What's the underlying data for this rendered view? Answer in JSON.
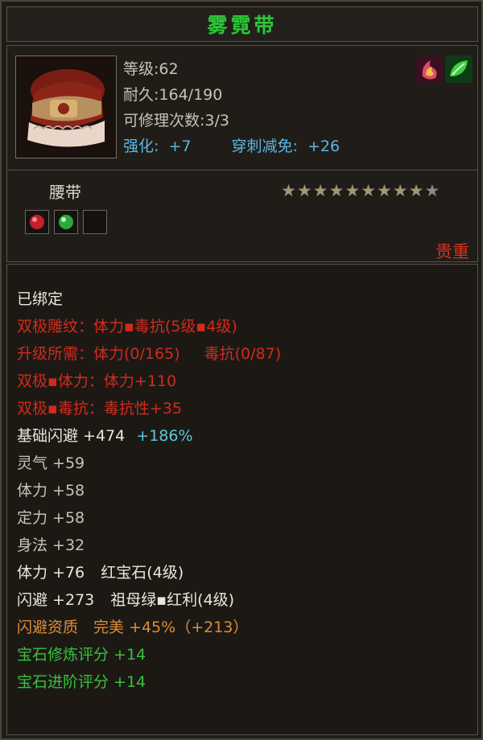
{
  "item": {
    "name": "雾霓带",
    "level": "等级:62",
    "durability": "耐久:164/190",
    "repair_count": "可修理次数:3/3",
    "enhance_label": "强化:",
    "enhance_value": "+7",
    "pierce_label": "穿刺减免:",
    "pierce_value": "+26",
    "category": "腰带",
    "quality": "贵重",
    "stars_filled": 9,
    "stars_total": 10,
    "gem_slots": [
      "red-gem-icon",
      "green-gem-icon",
      "empty-slot"
    ]
  },
  "set_icons": [
    "flame-set-icon",
    "leaf-set-icon"
  ],
  "attributes": {
    "bound": "已绑定",
    "dual_pattern": "双极雕纹：体力▪毒抗(5级▪4级)",
    "upgrade_need_a": "升级所需：体力(0/165)",
    "upgrade_need_b": "毒抗(0/87)",
    "dual_body": "双极▪体力：体力+110",
    "dual_poison": "双极▪毒抗：毒抗性+35",
    "base_dodge": "基础闪避 +474",
    "base_dodge_pct": "+186%",
    "spirit": "灵气 +59",
    "body": "体力 +58",
    "focus": "定力 +58",
    "agility": "身法 +32",
    "gem_body": "体力 +76",
    "gem_body_name": "红宝石(4级)",
    "gem_dodge": "闪避 +273",
    "gem_dodge_name": "祖母绿▪红利(4级)",
    "dodge_quality": "闪避资质　完美 +45%（+213）",
    "gem_refine": "宝石修炼评分 +14",
    "gem_advance": "宝石进阶评分 +14"
  },
  "colors": {
    "title": "#2fc23b",
    "red": "#d22a1c",
    "cyan": "#58c8d8",
    "orange": "#dc8c3a",
    "green": "#38c13c"
  }
}
